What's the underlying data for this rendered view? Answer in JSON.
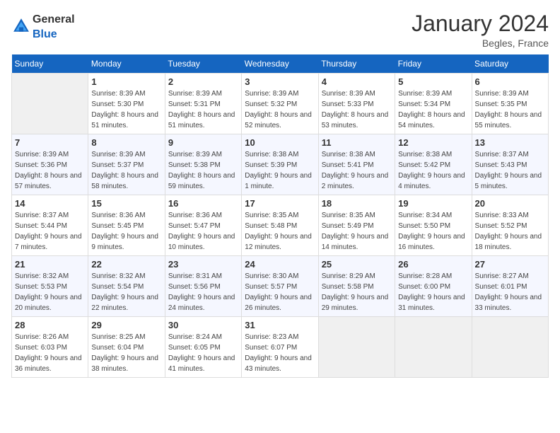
{
  "header": {
    "logo_general": "General",
    "logo_blue": "Blue",
    "month_title": "January 2024",
    "location": "Begles, France"
  },
  "weekdays": [
    "Sunday",
    "Monday",
    "Tuesday",
    "Wednesday",
    "Thursday",
    "Friday",
    "Saturday"
  ],
  "weeks": [
    {
      "days": [
        {
          "number": "",
          "sunrise": "",
          "sunset": "",
          "daylight": ""
        },
        {
          "number": "1",
          "sunrise": "Sunrise: 8:39 AM",
          "sunset": "Sunset: 5:30 PM",
          "daylight": "Daylight: 8 hours and 51 minutes."
        },
        {
          "number": "2",
          "sunrise": "Sunrise: 8:39 AM",
          "sunset": "Sunset: 5:31 PM",
          "daylight": "Daylight: 8 hours and 51 minutes."
        },
        {
          "number": "3",
          "sunrise": "Sunrise: 8:39 AM",
          "sunset": "Sunset: 5:32 PM",
          "daylight": "Daylight: 8 hours and 52 minutes."
        },
        {
          "number": "4",
          "sunrise": "Sunrise: 8:39 AM",
          "sunset": "Sunset: 5:33 PM",
          "daylight": "Daylight: 8 hours and 53 minutes."
        },
        {
          "number": "5",
          "sunrise": "Sunrise: 8:39 AM",
          "sunset": "Sunset: 5:34 PM",
          "daylight": "Daylight: 8 hours and 54 minutes."
        },
        {
          "number": "6",
          "sunrise": "Sunrise: 8:39 AM",
          "sunset": "Sunset: 5:35 PM",
          "daylight": "Daylight: 8 hours and 55 minutes."
        }
      ]
    },
    {
      "days": [
        {
          "number": "7",
          "sunrise": "Sunrise: 8:39 AM",
          "sunset": "Sunset: 5:36 PM",
          "daylight": "Daylight: 8 hours and 57 minutes."
        },
        {
          "number": "8",
          "sunrise": "Sunrise: 8:39 AM",
          "sunset": "Sunset: 5:37 PM",
          "daylight": "Daylight: 8 hours and 58 minutes."
        },
        {
          "number": "9",
          "sunrise": "Sunrise: 8:39 AM",
          "sunset": "Sunset: 5:38 PM",
          "daylight": "Daylight: 8 hours and 59 minutes."
        },
        {
          "number": "10",
          "sunrise": "Sunrise: 8:38 AM",
          "sunset": "Sunset: 5:39 PM",
          "daylight": "Daylight: 9 hours and 1 minute."
        },
        {
          "number": "11",
          "sunrise": "Sunrise: 8:38 AM",
          "sunset": "Sunset: 5:41 PM",
          "daylight": "Daylight: 9 hours and 2 minutes."
        },
        {
          "number": "12",
          "sunrise": "Sunrise: 8:38 AM",
          "sunset": "Sunset: 5:42 PM",
          "daylight": "Daylight: 9 hours and 4 minutes."
        },
        {
          "number": "13",
          "sunrise": "Sunrise: 8:37 AM",
          "sunset": "Sunset: 5:43 PM",
          "daylight": "Daylight: 9 hours and 5 minutes."
        }
      ]
    },
    {
      "days": [
        {
          "number": "14",
          "sunrise": "Sunrise: 8:37 AM",
          "sunset": "Sunset: 5:44 PM",
          "daylight": "Daylight: 9 hours and 7 minutes."
        },
        {
          "number": "15",
          "sunrise": "Sunrise: 8:36 AM",
          "sunset": "Sunset: 5:45 PM",
          "daylight": "Daylight: 9 hours and 9 minutes."
        },
        {
          "number": "16",
          "sunrise": "Sunrise: 8:36 AM",
          "sunset": "Sunset: 5:47 PM",
          "daylight": "Daylight: 9 hours and 10 minutes."
        },
        {
          "number": "17",
          "sunrise": "Sunrise: 8:35 AM",
          "sunset": "Sunset: 5:48 PM",
          "daylight": "Daylight: 9 hours and 12 minutes."
        },
        {
          "number": "18",
          "sunrise": "Sunrise: 8:35 AM",
          "sunset": "Sunset: 5:49 PM",
          "daylight": "Daylight: 9 hours and 14 minutes."
        },
        {
          "number": "19",
          "sunrise": "Sunrise: 8:34 AM",
          "sunset": "Sunset: 5:50 PM",
          "daylight": "Daylight: 9 hours and 16 minutes."
        },
        {
          "number": "20",
          "sunrise": "Sunrise: 8:33 AM",
          "sunset": "Sunset: 5:52 PM",
          "daylight": "Daylight: 9 hours and 18 minutes."
        }
      ]
    },
    {
      "days": [
        {
          "number": "21",
          "sunrise": "Sunrise: 8:32 AM",
          "sunset": "Sunset: 5:53 PM",
          "daylight": "Daylight: 9 hours and 20 minutes."
        },
        {
          "number": "22",
          "sunrise": "Sunrise: 8:32 AM",
          "sunset": "Sunset: 5:54 PM",
          "daylight": "Daylight: 9 hours and 22 minutes."
        },
        {
          "number": "23",
          "sunrise": "Sunrise: 8:31 AM",
          "sunset": "Sunset: 5:56 PM",
          "daylight": "Daylight: 9 hours and 24 minutes."
        },
        {
          "number": "24",
          "sunrise": "Sunrise: 8:30 AM",
          "sunset": "Sunset: 5:57 PM",
          "daylight": "Daylight: 9 hours and 26 minutes."
        },
        {
          "number": "25",
          "sunrise": "Sunrise: 8:29 AM",
          "sunset": "Sunset: 5:58 PM",
          "daylight": "Daylight: 9 hours and 29 minutes."
        },
        {
          "number": "26",
          "sunrise": "Sunrise: 8:28 AM",
          "sunset": "Sunset: 6:00 PM",
          "daylight": "Daylight: 9 hours and 31 minutes."
        },
        {
          "number": "27",
          "sunrise": "Sunrise: 8:27 AM",
          "sunset": "Sunset: 6:01 PM",
          "daylight": "Daylight: 9 hours and 33 minutes."
        }
      ]
    },
    {
      "days": [
        {
          "number": "28",
          "sunrise": "Sunrise: 8:26 AM",
          "sunset": "Sunset: 6:03 PM",
          "daylight": "Daylight: 9 hours and 36 minutes."
        },
        {
          "number": "29",
          "sunrise": "Sunrise: 8:25 AM",
          "sunset": "Sunset: 6:04 PM",
          "daylight": "Daylight: 9 hours and 38 minutes."
        },
        {
          "number": "30",
          "sunrise": "Sunrise: 8:24 AM",
          "sunset": "Sunset: 6:05 PM",
          "daylight": "Daylight: 9 hours and 41 minutes."
        },
        {
          "number": "31",
          "sunrise": "Sunrise: 8:23 AM",
          "sunset": "Sunset: 6:07 PM",
          "daylight": "Daylight: 9 hours and 43 minutes."
        },
        {
          "number": "",
          "sunrise": "",
          "sunset": "",
          "daylight": ""
        },
        {
          "number": "",
          "sunrise": "",
          "sunset": "",
          "daylight": ""
        },
        {
          "number": "",
          "sunrise": "",
          "sunset": "",
          "daylight": ""
        }
      ]
    }
  ]
}
